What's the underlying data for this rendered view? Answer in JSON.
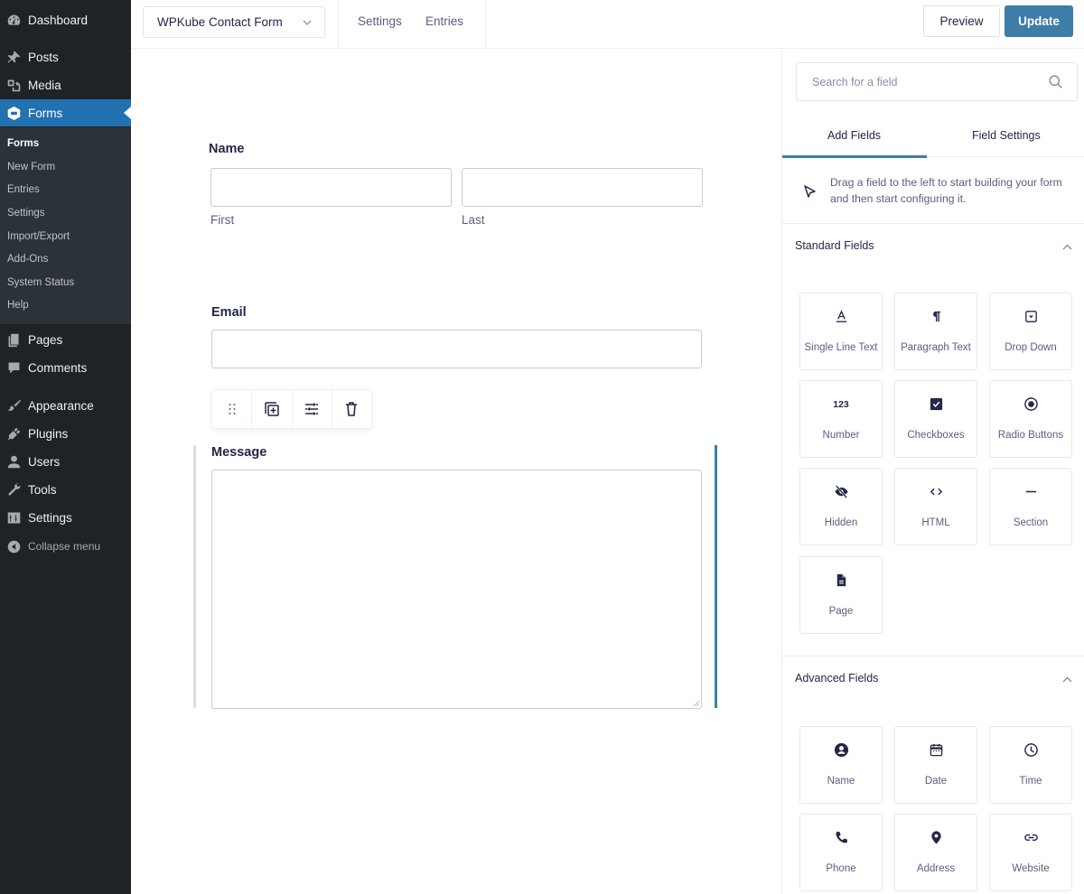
{
  "admin_menu": {
    "items": [
      {
        "label": "Dashboard",
        "icon": "dashboard-icon"
      },
      {
        "label": "Posts",
        "icon": "pin-icon"
      },
      {
        "label": "Media",
        "icon": "media-icon"
      },
      {
        "label": "Forms",
        "icon": "forms-icon",
        "current": true
      },
      {
        "label": "Pages",
        "icon": "pages-icon"
      },
      {
        "label": "Comments",
        "icon": "comment-icon"
      },
      {
        "label": "Appearance",
        "icon": "brush-icon"
      },
      {
        "label": "Plugins",
        "icon": "plugin-icon"
      },
      {
        "label": "Users",
        "icon": "user-icon"
      },
      {
        "label": "Tools",
        "icon": "wrench-icon"
      },
      {
        "label": "Settings",
        "icon": "settings-icon"
      }
    ],
    "submenu": [
      "Forms",
      "New Form",
      "Entries",
      "Settings",
      "Import/Export",
      "Add-Ons",
      "System Status",
      "Help"
    ],
    "collapse_label": "Collapse menu"
  },
  "topbar": {
    "form_name": "WPKube Contact Form",
    "links": [
      "Settings",
      "Entries"
    ],
    "preview_label": "Preview",
    "update_label": "Update"
  },
  "form": {
    "name_label": "Name",
    "name_first_sublabel": "First",
    "name_last_sublabel": "Last",
    "email_label": "Email",
    "message_label": "Message",
    "toolbar": [
      "drag-handle",
      "duplicate",
      "settings",
      "delete"
    ]
  },
  "panel": {
    "search_placeholder": "Search for a field",
    "tabs": [
      "Add Fields",
      "Field Settings"
    ],
    "active_tab": "Add Fields",
    "hint": "Drag a field to the left to start building your form and then start configuring it.",
    "standard_title": "Standard Fields",
    "standard_fields": [
      "Single Line Text",
      "Paragraph Text",
      "Drop Down",
      "Number",
      "Checkboxes",
      "Radio Buttons",
      "Hidden",
      "HTML",
      "Section",
      "Page"
    ],
    "advanced_title": "Advanced Fields",
    "advanced_fields": [
      "Name",
      "Date",
      "Time",
      "Phone",
      "Address",
      "Website"
    ]
  },
  "colors": {
    "accent": "#3e7da6",
    "wp_blue": "#2271b1",
    "sidebar_bg": "#1d2327",
    "submenu_bg": "#2c3338"
  }
}
